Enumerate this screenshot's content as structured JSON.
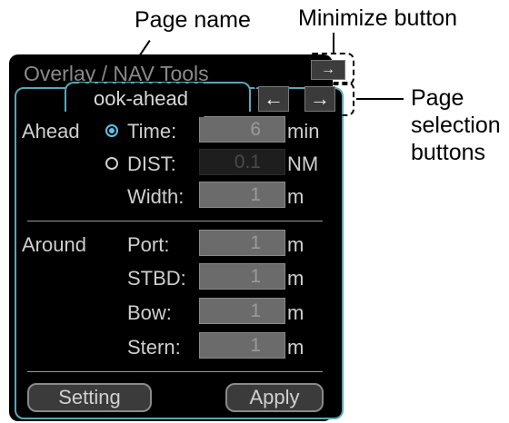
{
  "callouts": {
    "page_name": "Page name",
    "minimize": "Minimize button",
    "page_selection_1": "Page",
    "page_selection_2": "selection",
    "page_selection_3": "buttons"
  },
  "window": {
    "title": "Overlay / NAV Tools",
    "minimize_glyph": "→"
  },
  "tab": {
    "label": "ook-ahead"
  },
  "page_buttons": {
    "prev_glyph": "←",
    "next_glyph": "→"
  },
  "ahead": {
    "section_label": "Ahead",
    "time": {
      "label": "Time:",
      "value": "6",
      "unit": "min",
      "selected": true
    },
    "dist": {
      "label": "DIST:",
      "value": "0.1",
      "unit": "NM",
      "selected": false
    },
    "width": {
      "label": "Width:",
      "value": "1",
      "unit": "m"
    }
  },
  "around": {
    "section_label": "Around",
    "port": {
      "label": "Port:",
      "value": "1",
      "unit": "m"
    },
    "stbd": {
      "label": "STBD:",
      "value": "1",
      "unit": "m"
    },
    "bow": {
      "label": "Bow:",
      "value": "1",
      "unit": "m"
    },
    "stern": {
      "label": "Stern:",
      "value": "1",
      "unit": "m"
    }
  },
  "actions": {
    "setting": "Setting",
    "apply": "Apply"
  },
  "colors": {
    "accent": "#5aa7b7",
    "radio_selected": "#5bc3ea",
    "field": "#6b6b6b",
    "panel": "#000000"
  }
}
